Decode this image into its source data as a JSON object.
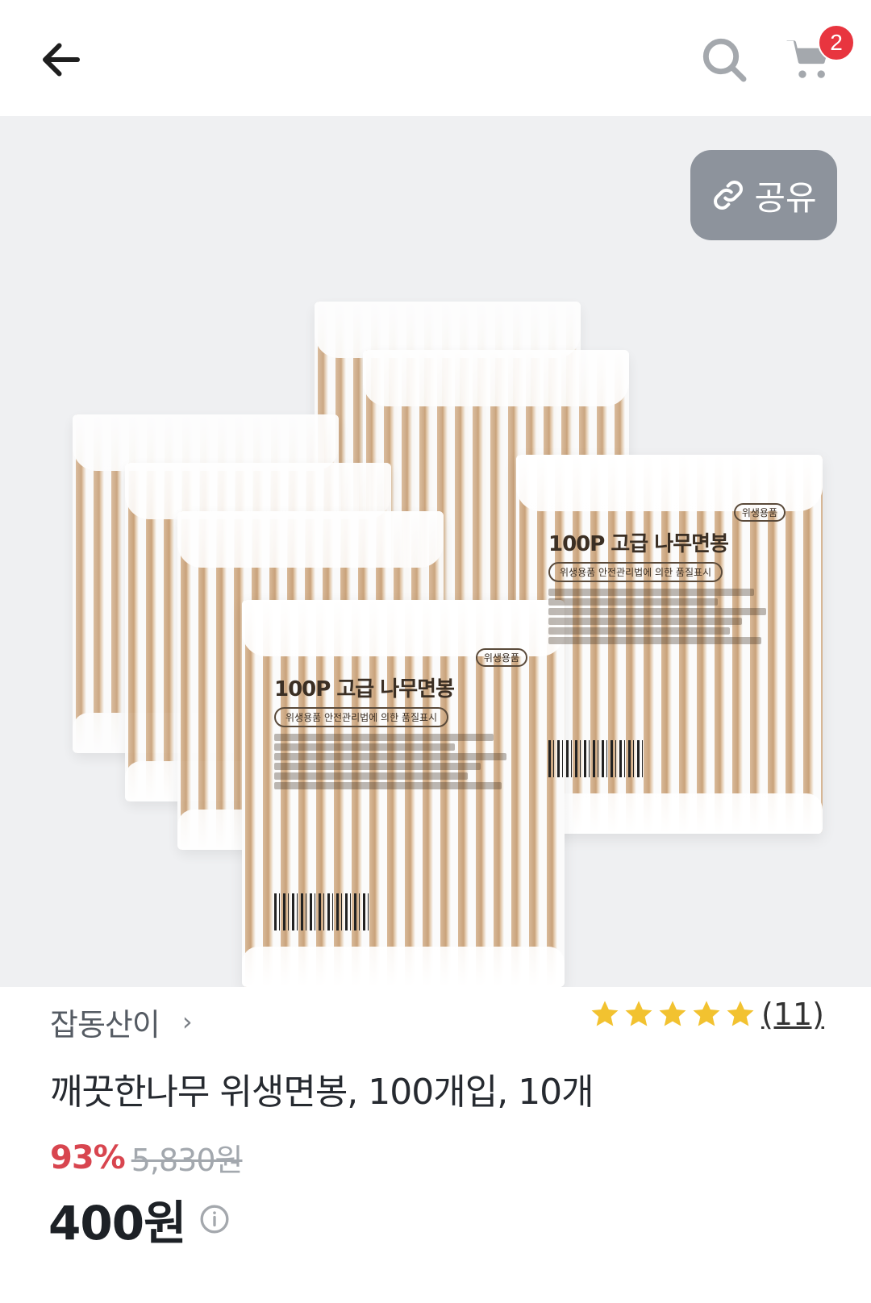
{
  "header": {
    "back_icon": "arrow-left-icon",
    "search_icon": "search-icon",
    "cart_icon": "cart-icon",
    "cart_count": "2"
  },
  "hero": {
    "share_label": "공유",
    "share_icon": "link-icon",
    "pack_title": "100P 고급 나무면봉",
    "pack_subtitle": "위생용품 안전관리법에 의한 품질표시",
    "pack_tag": "위생용품"
  },
  "product": {
    "seller": "잡동산이",
    "seller_chevron": "›",
    "rating_stars": 5,
    "rating_count": "(11)",
    "title": "깨끗한나무 위생면봉, 100개입, 10개",
    "discount": "93%",
    "original_price": "5,830원",
    "price": "400원",
    "accent_color": "#d8454f",
    "star_color": "#f2c230"
  }
}
